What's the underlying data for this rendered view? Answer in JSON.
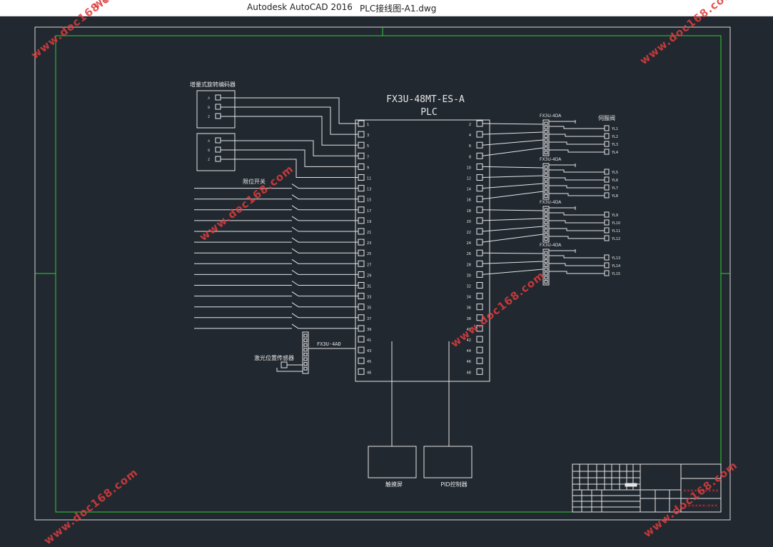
{
  "window": {
    "app_title": "Autodesk AutoCAD 2016",
    "document_title": "PLC接线图-A1.dwg"
  },
  "drawing": {
    "plc_model": "FX3U-48MT-ES-A",
    "plc_label": "PLC",
    "encoder_label": "增量式旋转编码器",
    "encoder_pins": [
      "A",
      "B",
      "Z"
    ],
    "limit_switch_label": "限位开关",
    "laser_sensor_label": "激光位置传感器",
    "ad_module": "FX3U-4AD",
    "da_modules": [
      "FX3U-4DA",
      "FX3U-4DA",
      "FX3U-4DA",
      "FX3U-4DA"
    ],
    "servo_label": "伺服阀",
    "servo_channels": [
      [
        "YL1",
        "YL2",
        "YL3",
        "YL4"
      ],
      [
        "YL5",
        "YL6",
        "YL7",
        "YL8"
      ],
      [
        "YL9",
        "YL10",
        "YL11",
        "YL12"
      ],
      [
        "YL13",
        "YL14",
        "YL15"
      ]
    ],
    "plc_left_terminals": [
      "1",
      "3",
      "5",
      "7",
      "9",
      "11",
      "13",
      "15",
      "17",
      "19",
      "21",
      "23",
      "25",
      "27",
      "29",
      "31",
      "33",
      "35",
      "37",
      "39",
      "41",
      "43",
      "45",
      "46"
    ],
    "plc_right_terminals": [
      "2",
      "4",
      "6",
      "8",
      "10",
      "12",
      "14",
      "16",
      "18",
      "20",
      "22",
      "24",
      "26",
      "28",
      "30",
      "32",
      "34",
      "36",
      "38",
      "40",
      "42",
      "44",
      "46",
      "48"
    ],
    "touchscreen_label": "触摸屏",
    "pid_label": "PID控制器"
  },
  "title_block": {
    "company_text": "××××××××××",
    "drawing_no": "××××××-×××"
  },
  "watermarks": [
    "www.doc168.com"
  ],
  "colors": {
    "background": "#212830",
    "frame_outer": "#d8d8d8",
    "frame_inner": "#33cc33",
    "lines": "#e6e6e6",
    "watermark": "#e03c3c"
  }
}
